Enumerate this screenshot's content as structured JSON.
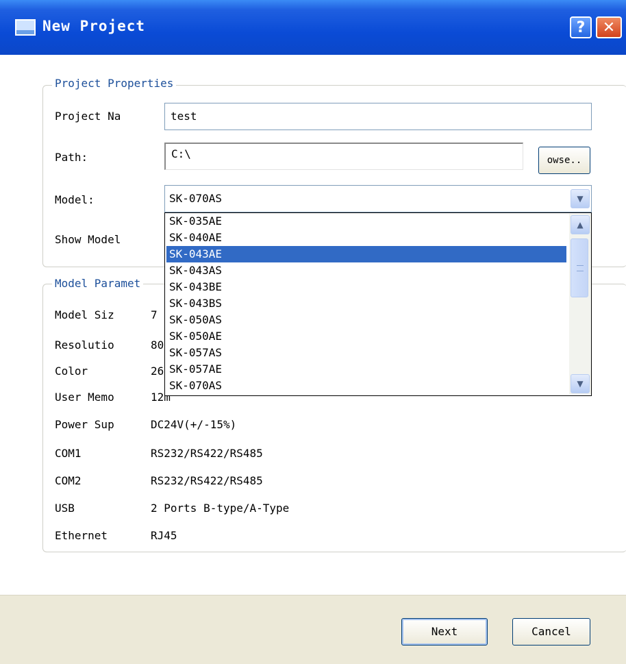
{
  "window": {
    "title": "New Project",
    "help_label": "?",
    "close_label": "✕"
  },
  "project_properties": {
    "legend": "Project Properties",
    "name_label": "Project Na",
    "name_value": "test",
    "path_label": "Path:",
    "path_value": "C:\\",
    "browse_label": "owse..",
    "model_label": "Model:",
    "model_selected": "SK-070AS",
    "show_model_label": "Show Model"
  },
  "model_dropdown": {
    "items": [
      "SK-035AE",
      "SK-040AE",
      "SK-043AE",
      "SK-043AS",
      "SK-043BE",
      "SK-043BS",
      "SK-050AS",
      "SK-050AE",
      "SK-057AS",
      "SK-057AE",
      "SK-070AS"
    ],
    "highlighted": "SK-043AE",
    "scroll_up": "▲",
    "scroll_down": "▼",
    "combo_arrow": "▼"
  },
  "model_parameters": {
    "legend": "Model Paramet",
    "rows": [
      {
        "label": "Model Siz",
        "value": "7"
      },
      {
        "label": "Resolutio",
        "value": "80"
      },
      {
        "label": "Color",
        "value": "26"
      },
      {
        "label": "User Memo",
        "value": "12m"
      },
      {
        "label": "Power Sup",
        "value": "DC24V(+/-15%)"
      },
      {
        "label": "COM1",
        "value": "RS232/RS422/RS485"
      },
      {
        "label": "COM2",
        "value": "RS232/RS422/RS485"
      },
      {
        "label": "USB",
        "value": "2 Ports B-type/A-Type"
      },
      {
        "label": "Ethernet",
        "value": "RJ45"
      }
    ]
  },
  "footer": {
    "next_label": "Next",
    "cancel_label": "Cancel"
  },
  "colors": {
    "titlebar": "#0a4bd6",
    "highlight": "#316ac5",
    "legend_text": "#1c4f9a",
    "footer_bg": "#ece9d8"
  }
}
